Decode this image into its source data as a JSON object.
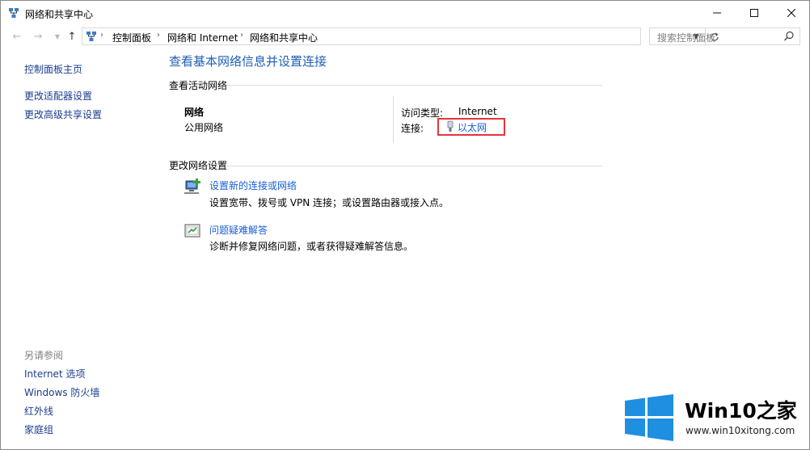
{
  "window": {
    "title": "网络和共享中心"
  },
  "address": {
    "crumbs": [
      "控制面板",
      "网络和 Internet",
      "网络和共享中心"
    ]
  },
  "search": {
    "placeholder": "搜索控制面板"
  },
  "sidebar": {
    "links": [
      "控制面板主页",
      "更改适配器设置",
      "更改高级共享设置"
    ],
    "see_also_heading": "另请参阅",
    "see_also": [
      "Internet 选项",
      "Windows 防火墙",
      "红外线",
      "家庭组"
    ]
  },
  "main": {
    "title": "查看基本网络信息并设置连接",
    "active_heading": "查看活动网络",
    "network_name": "网络",
    "network_type": "公用网络",
    "access_type_label": "访问类型:",
    "access_type_value": "Internet",
    "connection_label": "连接:",
    "connection_value": "以太网",
    "change_heading": "更改网络设置",
    "tasks": [
      {
        "label": "设置新的连接或网络",
        "desc": "设置宽带、拨号或 VPN 连接；或设置路由器或接入点。"
      },
      {
        "label": "问题疑难解答",
        "desc": "诊断并修复网络问题，或者获得疑难解答信息。"
      }
    ]
  },
  "watermark": {
    "brand": "Win10之家",
    "url": "www.win10xitong.com"
  },
  "colors": {
    "link": "#1a5fd6",
    "title": "#1e5fb4",
    "highlight": "#e0363b",
    "win_blue": "#1e8fe1"
  },
  "icons": [
    "network-center-icon",
    "back-arrow-icon",
    "forward-arrow-icon",
    "up-arrow-icon",
    "refresh-icon",
    "search-icon",
    "ethernet-icon",
    "new-connection-icon",
    "troubleshoot-icon",
    "windows-logo"
  ]
}
